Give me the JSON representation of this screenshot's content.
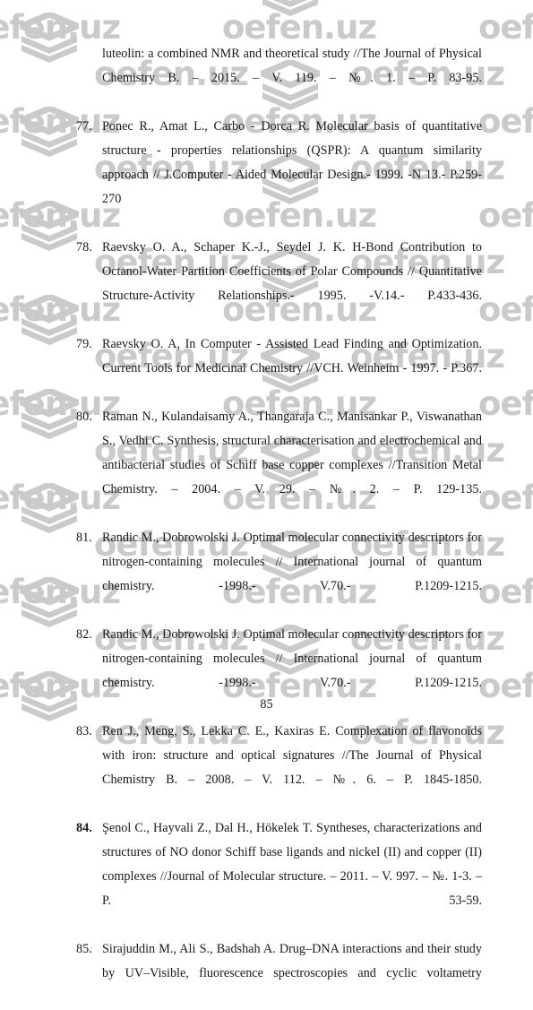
{
  "document": {
    "page_number": "85",
    "continued_entry": {
      "text": "luteolin: a combined NMR and theoretical study //The Journal of Physical Chemistry B. – 2015. – V. 119. – №. 1. – P. 83-95."
    },
    "references": [
      {
        "number": "77.",
        "bold": false,
        "text": "Ponec R., Amat L., Carbo - Dorca R.    Molecular basis of quantitative structure - properties relationships (QSPR): A quantum similarity approach // J.Computer - Aided Molecular Design.- 1999. -N 13.- P.259-270"
      },
      {
        "number": "78.",
        "bold": false,
        "text": "Raevsky O. A., Schaper K.-J., Seydel J. K. H-Bond Contribution to Octanol-Water Partition Coefficients of Polar Compounds // Quantitative Structure-Activity Relationships.- 1995. -V.14.- P.433-436."
      },
      {
        "number": "79.",
        "bold": false,
        "text": "Raevsky O. A, In Computer - Assisted Lead Finding and Optimization. Current Tools for Medicinal Chemistry //VCH. Weinheim - 1997. - P.367."
      },
      {
        "number": "80.",
        "bold": false,
        "text": "Raman N., Kulandaisamy A., Thangaraja C., Manisankar P., Viswanathan S., Vedhi C. Synthesis, structural characterisation and electrochemical and antibacterial studies of Schiff base copper complexes //Transition Metal Chemistry. – 2004. – V. 29. – №. 2. – P. 129-135."
      },
      {
        "number": "81.",
        "bold": false,
        "text": "Randic M., Dobrowolski J. Optimal molecular connectivity descriptors for nitrogen-containing molecules // International journal of quantum chemistry. -1998.- V.70.- P.1209-1215."
      },
      {
        "number": "82.",
        "bold": false,
        "text": "Randic M., Dobrowolski J. Optimal molecular connectivity descriptors for nitrogen-containing molecules // International journal of quantum chemistry. -1998.- V.70.- P.1209-1215."
      },
      {
        "number": "83.",
        "bold": false,
        "text": "Ren J., Meng, S., Lekka C. E., Kaxiras E. Complexation of flavonoids with iron: structure and optical signatures //The Journal of Physical Chemistry B. – 2008. – V. 112. – №. 6. – P. 1845-1850."
      },
      {
        "number": "84.",
        "bold": true,
        "text": "Şenol C., Hayvali Z., Dal H., Hökelek T. Syntheses, characterizations and structures of NO donor Schiff base ligands and nickel (II) and copper (II) complexes //Journal of Molecular structure. – 2011. – V. 997. – №. 1-3. – P. 53-59."
      },
      {
        "number": "85.",
        "bold": false,
        "text": "Sirajuddin M., Ali S., Badshah A. Drug–DNA interactions and their study by UV–Visible, fluorescence spectroscopies and cyclic voltametry"
      }
    ]
  },
  "watermark": {
    "text": "oefen.uz",
    "color": "#cacaca",
    "logo_icon": "stacked-layers-icon"
  }
}
